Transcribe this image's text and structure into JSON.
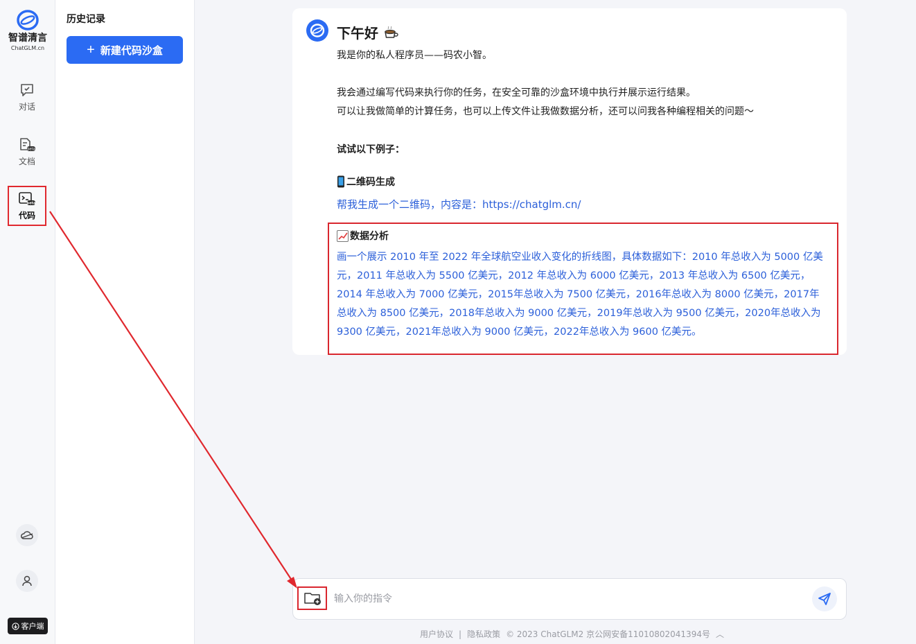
{
  "logo": {
    "name_cn": "智谱清言",
    "name_en": "ChatGLM.cn"
  },
  "nav": {
    "items": [
      {
        "label": "对话",
        "icon": "chat-icon"
      },
      {
        "label": "文档",
        "icon": "document-beta-icon"
      },
      {
        "label": "代码",
        "icon": "code-beta-icon"
      }
    ],
    "client_label": "客户端"
  },
  "history": {
    "title": "历史记录",
    "new_button": "新建代码沙盒"
  },
  "welcome": {
    "greeting": "下午好",
    "intro": "我是你的私人程序员——码农小智。",
    "desc1": "我会通过编写代码来执行你的任务，在安全可靠的沙盒环境中执行并展示运行结果。",
    "desc2": "可以让我做简单的计算任务，也可以上传文件让我做数据分析，还可以问我各种编程相关的问题～",
    "examples_title": "试试以下例子：",
    "example1_title": "二维码生成",
    "example1_text": "帮我生成一个二维码，内容是：https://chatglm.cn/",
    "example2_title": "数据分析",
    "example2_text": "画一个展示 2010 年至 2022 年全球航空业收入变化的折线图，具体数据如下：2010 年总收入为 5000 亿美元，2011 年总收入为 5500 亿美元，2012 年总收入为 6000 亿美元，2013 年总收入为 6500 亿美元，2014 年总收入为 7000 亿美元，2015年总收入为 7500 亿美元，2016年总收入为 8000 亿美元，2017年总收入为 8500 亿美元，2018年总收入为 9000 亿美元，2019年总收入为 9500 亿美元，2020年总收入为 9300 亿美元，2021年总收入为 9000 亿美元，2022年总收入为 9600 亿美元。"
  },
  "input": {
    "placeholder": "输入你的指令"
  },
  "footer": {
    "agreement": "用户协议",
    "sep": "|",
    "privacy": "隐私政策",
    "copyright": "© 2023 ChatGLM2 京公网安备11010802041394号"
  },
  "colors": {
    "accent": "#2b6bf3",
    "link": "#2b5fd9",
    "annotation": "#d9262e"
  }
}
